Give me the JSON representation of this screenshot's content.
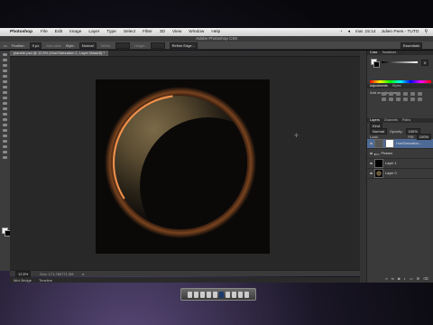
{
  "menubar": {
    "app": "Photoshop",
    "items": [
      "File",
      "Edit",
      "Image",
      "Layer",
      "Type",
      "Select",
      "Filter",
      "3D",
      "View",
      "Window",
      "Help"
    ],
    "clock": "mar. 15:14",
    "user": "Julien Pees - TUTO"
  },
  "window": {
    "title": "Adobe Photoshop CS6"
  },
  "options": {
    "feather_label": "Feather:",
    "feather_value": "0 px",
    "antialias": "Anti-alias",
    "style_label": "Style:",
    "style_value": "Normal",
    "width_label": "Width:",
    "height_label": "Height:",
    "refine": "Refine Edge...",
    "workspace": "Essentials"
  },
  "document": {
    "tab": "planete.psd @ 12,5% (Hue/Saturation 1, Layer Mask/8) *"
  },
  "status": {
    "zoom": "12,5%",
    "doc": "Doc: 171,7M/771,3M"
  },
  "bottom_tabs": [
    "Mini Bridge",
    "Timeline"
  ],
  "panels": {
    "color_tabs": [
      "Color",
      "Swatches"
    ],
    "color_values": [
      "0",
      "0"
    ],
    "adj_tabs": [
      "Adjustments",
      "Styles"
    ],
    "adj_caption": "Add an adjustment",
    "layer_tabs": [
      "Layers",
      "Channels",
      "Paths"
    ],
    "kind": "Kind",
    "blend": "Normal",
    "opacity_label": "Opacity:",
    "opacity": "100%",
    "lock_label": "Lock:",
    "fill_label": "Fill:",
    "fill": "100%",
    "layers": [
      {
        "name": "Hue/Saturation...",
        "thumb": "white",
        "selected": true
      },
      {
        "name": "Phases",
        "thumb": "folder",
        "selected": false
      },
      {
        "name": "Layer 1",
        "thumb": "black",
        "selected": false
      },
      {
        "name": "Layer 0",
        "thumb": "planet",
        "selected": false
      }
    ]
  }
}
